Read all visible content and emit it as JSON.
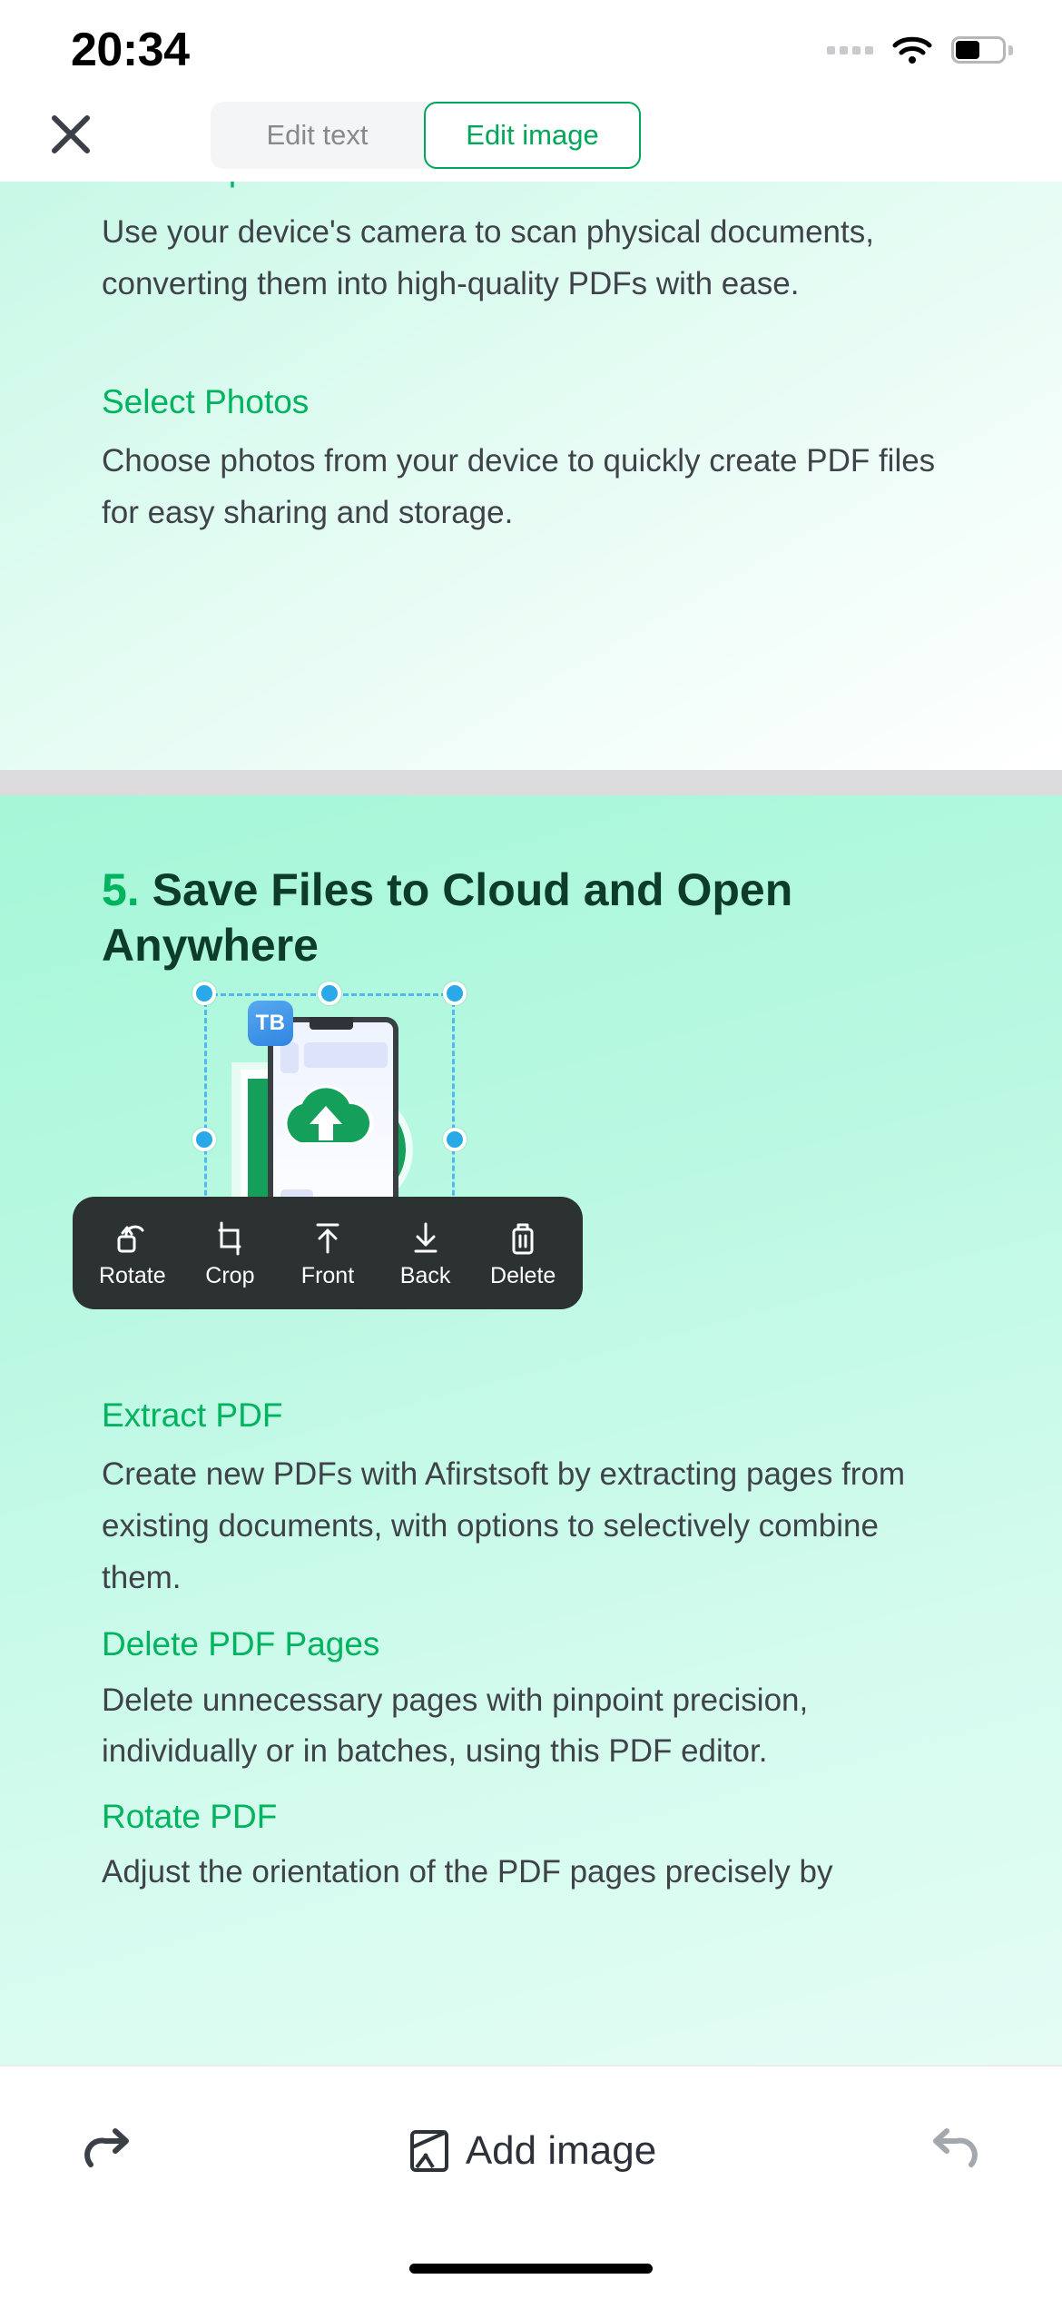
{
  "status_bar": {
    "time": "20:34",
    "signal_icon": "signal-dots-icon",
    "wifi_icon": "wifi-icon",
    "battery_icon": "battery-icon"
  },
  "top_nav": {
    "close_icon": "close-icon",
    "tabs": [
      {
        "label": "Edit text",
        "active": false,
        "name": "tab-edit-text"
      },
      {
        "label": "Edit image",
        "active": true,
        "name": "tab-edit-image"
      }
    ]
  },
  "document": {
    "page_a": {
      "heading_clipped": "Scan Paper Files",
      "paragraph_1": "Use your device's camera to scan physical documents, converting them into high-quality PDFs with ease.",
      "heading_2": "Select Photos",
      "paragraph_2": "Choose photos from your device to quickly create PDF files for easy sharing and storage."
    },
    "page_b": {
      "big_heading_number": "5.",
      "big_heading_text": "Save Files to Cloud and Open Anywhere",
      "heading_extract": "Extract PDF",
      "paragraph_extract": "Create new PDFs with Afirstsoft by extracting pages from existing documents, with options to selectively combine them.",
      "heading_delete": "Delete PDF Pages",
      "paragraph_delete": "Delete unnecessary pages with pinpoint precision, individually or in batches, using this PDF editor.",
      "heading_rotate": "Rotate PDF",
      "paragraph_rotate_clipped": "Adjust the orientation of the PDF pages precisely by"
    }
  },
  "selection": {
    "badge_label": "TB",
    "handle_count": 8,
    "illustration_name": "cloud-upload-phone-illustration"
  },
  "context_toolbar": {
    "items": [
      {
        "label": "Rotate",
        "icon": "rotate-icon"
      },
      {
        "label": "Crop",
        "icon": "crop-icon"
      },
      {
        "label": "Front",
        "icon": "bring-to-front-icon"
      },
      {
        "label": "Back",
        "icon": "send-to-back-icon"
      },
      {
        "label": "Delete",
        "icon": "trash-icon"
      }
    ]
  },
  "bottom_bar": {
    "redo_icon": "redo-icon",
    "add_image_label": "Add image",
    "add_image_icon": "add-image-icon",
    "undo_icon": "undo-icon"
  },
  "colors": {
    "accent_green": "#00b35e",
    "heading_dark": "#0d3d2a",
    "handle_blue": "#2aa9e8",
    "badge_blue": "#2f85e0",
    "toolbar_dark": "#2b3231",
    "body_text": "#3f4349",
    "page_gap": "#dcdcde"
  }
}
